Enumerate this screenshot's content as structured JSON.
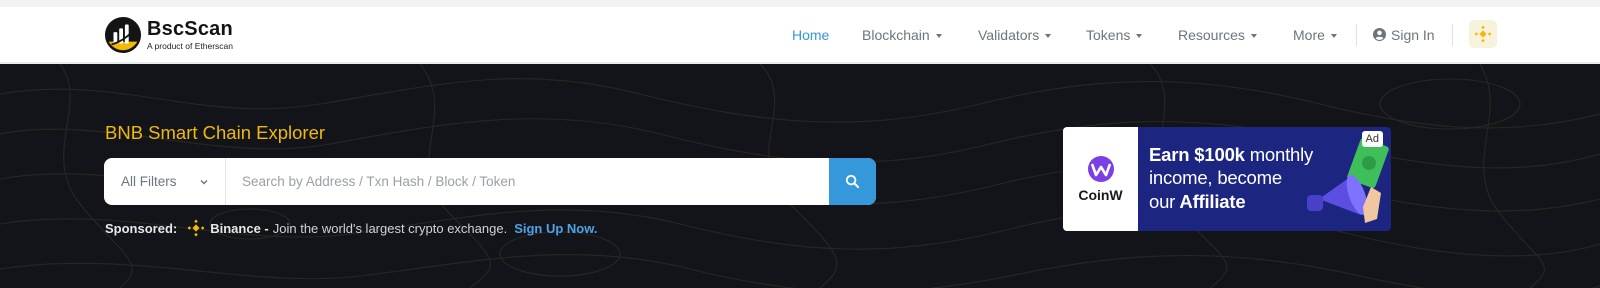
{
  "brand": {
    "name": "BscScan",
    "tagline": "A product of Etherscan"
  },
  "nav": {
    "items": [
      {
        "label": "Home"
      },
      {
        "label": "Blockchain"
      },
      {
        "label": "Validators"
      },
      {
        "label": "Tokens"
      },
      {
        "label": "Resources"
      },
      {
        "label": "More"
      }
    ],
    "signin": "Sign In"
  },
  "hero": {
    "title": "BNB Smart Chain Explorer",
    "filter_label": "All Filters",
    "search_placeholder": "Search by Address / Txn Hash / Block / Token"
  },
  "sponsored": {
    "label": "Sponsored:",
    "name": "Binance -",
    "text": "Join the world's largest crypto exchange.",
    "link": "Sign Up Now."
  },
  "ad": {
    "badge": "Ad",
    "brand": "CoinW",
    "line1_a": "Earn",
    "line1_b": "$100k",
    "line1_c": "monthly",
    "line2": "income, become",
    "line3_a": "our",
    "line3_b": "Affiliate"
  },
  "colors": {
    "accent": "#3498db",
    "bnb_gold": "#f0b90b",
    "hero_bg": "#121419",
    "ad_bg": "#1c2580"
  }
}
